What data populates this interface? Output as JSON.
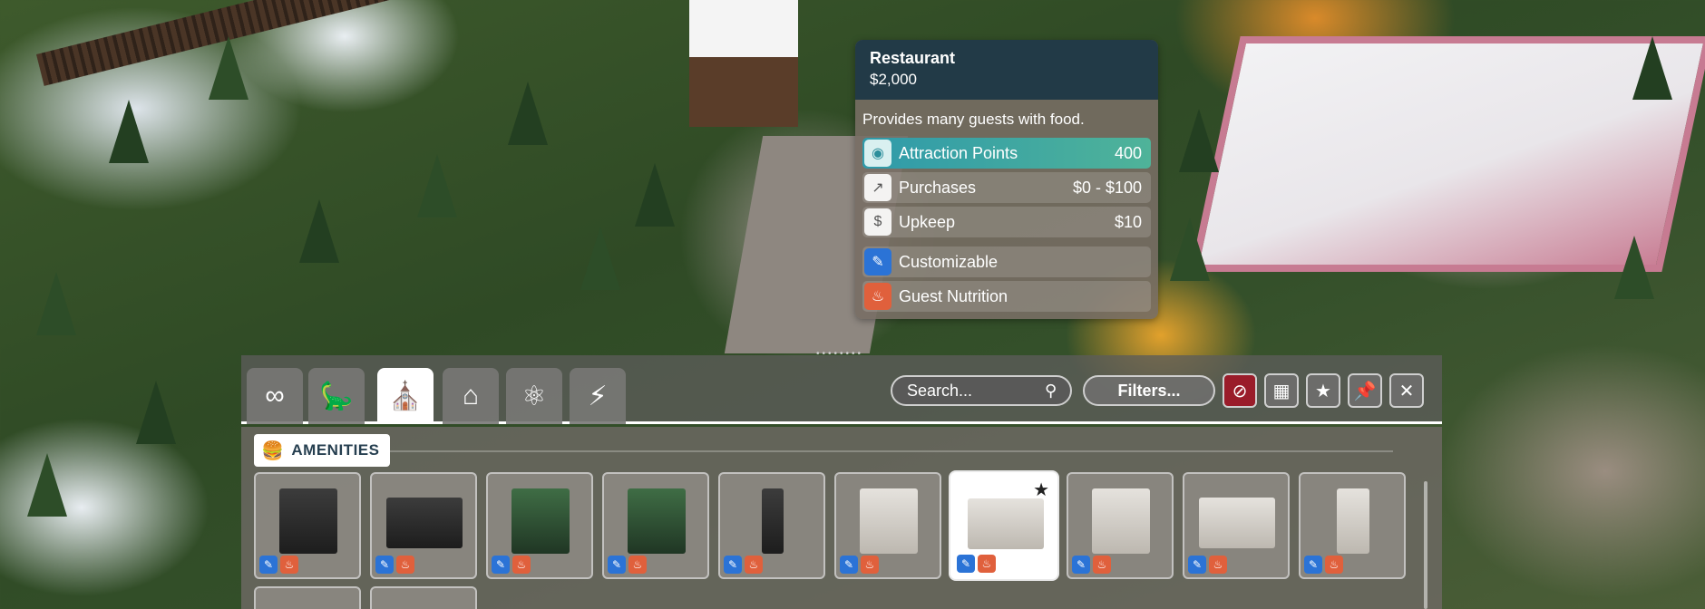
{
  "tooltip": {
    "title": "Restaurant",
    "price": "$2,000",
    "description": "Provides many guests with food.",
    "stats": [
      {
        "icon": "attraction-points-icon",
        "label": "Attraction Points",
        "value": "400"
      },
      {
        "icon": "purchases-chart-icon",
        "label": "Purchases",
        "value": "$0 - $100"
      },
      {
        "icon": "upkeep-coin-icon",
        "label": "Upkeep",
        "value": "$10"
      }
    ],
    "tags": [
      {
        "icon": "paintbrush-icon",
        "label": "Customizable",
        "color": "#2b73d6"
      },
      {
        "icon": "food-icon",
        "label": "Guest Nutrition",
        "color": "#e0603c"
      }
    ]
  },
  "toolbar": {
    "tabs": [
      {
        "icon": "infinity-icon"
      },
      {
        "icon": "dinosaur-icon"
      },
      {
        "icon": "guest-amenities-icon",
        "active": true
      },
      {
        "icon": "staff-building-icon"
      },
      {
        "icon": "science-building-icon"
      },
      {
        "icon": "power-icon"
      }
    ],
    "search_placeholder": "Search...",
    "filters_label": "Filters..."
  },
  "section": {
    "label": "AMENITIES"
  },
  "items": [
    {
      "name": "kiosk-small",
      "badges": [
        "blue",
        "orange"
      ]
    },
    {
      "name": "kiosk-wide",
      "badges": [
        "blue",
        "orange"
      ]
    },
    {
      "name": "vending-green",
      "badges": [
        "blue",
        "orange",
        "green"
      ]
    },
    {
      "name": "vending-green-2",
      "badges": [
        "blue",
        "orange",
        "green"
      ]
    },
    {
      "name": "pillar-stand",
      "badges": [
        "blue",
        "orange"
      ]
    },
    {
      "name": "drink-stand",
      "badges": [
        "blue",
        "orange"
      ]
    },
    {
      "name": "restaurant",
      "badges": [
        "blue",
        "orange"
      ],
      "selected": true,
      "favorite": true
    },
    {
      "name": "gift-shop",
      "badges": [
        "blue",
        "orange"
      ]
    },
    {
      "name": "shop-hall",
      "badges": [
        "blue",
        "orange"
      ]
    },
    {
      "name": "vending-machine",
      "badges": [
        "blue",
        "orange"
      ]
    }
  ],
  "colors": {
    "header_dark": "#223a47",
    "highlight_from": "#2f9aaa",
    "highlight_to": "#4fb399",
    "blue_tag": "#2b73d6",
    "orange_tag": "#e0603c",
    "red_button": "#9a1c2a"
  }
}
